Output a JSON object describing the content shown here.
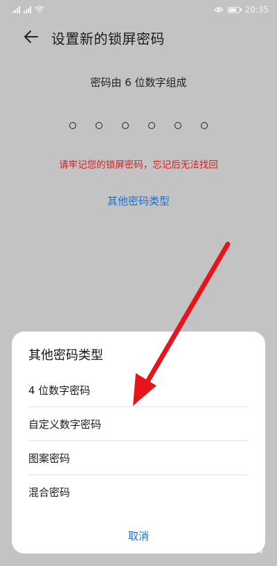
{
  "status_bar": {
    "time": "20:35",
    "icons": [
      "signal-icon",
      "wifi-icon",
      "eye-icon",
      "battery-icon"
    ]
  },
  "header": {
    "back_icon": "arrow-left-icon",
    "title": "设置新的锁屏密码"
  },
  "pin_entry": {
    "hint": "密码由 6 位数字组成",
    "digit_count": 6,
    "warning": "请牢记您的锁屏密码，忘记后无法找回",
    "other_types_link": "其他密码类型"
  },
  "sheet": {
    "title": "其他密码类型",
    "options": [
      {
        "label": "4 位数字密码"
      },
      {
        "label": "自定义数字密码"
      },
      {
        "label": "图案密码"
      },
      {
        "label": "混合密码"
      }
    ],
    "cancel_label": "取消"
  },
  "watermark": "Bai百",
  "colors": {
    "accent": "#1a6fd0",
    "warning": "#d32020",
    "annotation_arrow": "#e8141b",
    "background": "#c3c3c3",
    "sheet": "#ffffff"
  }
}
